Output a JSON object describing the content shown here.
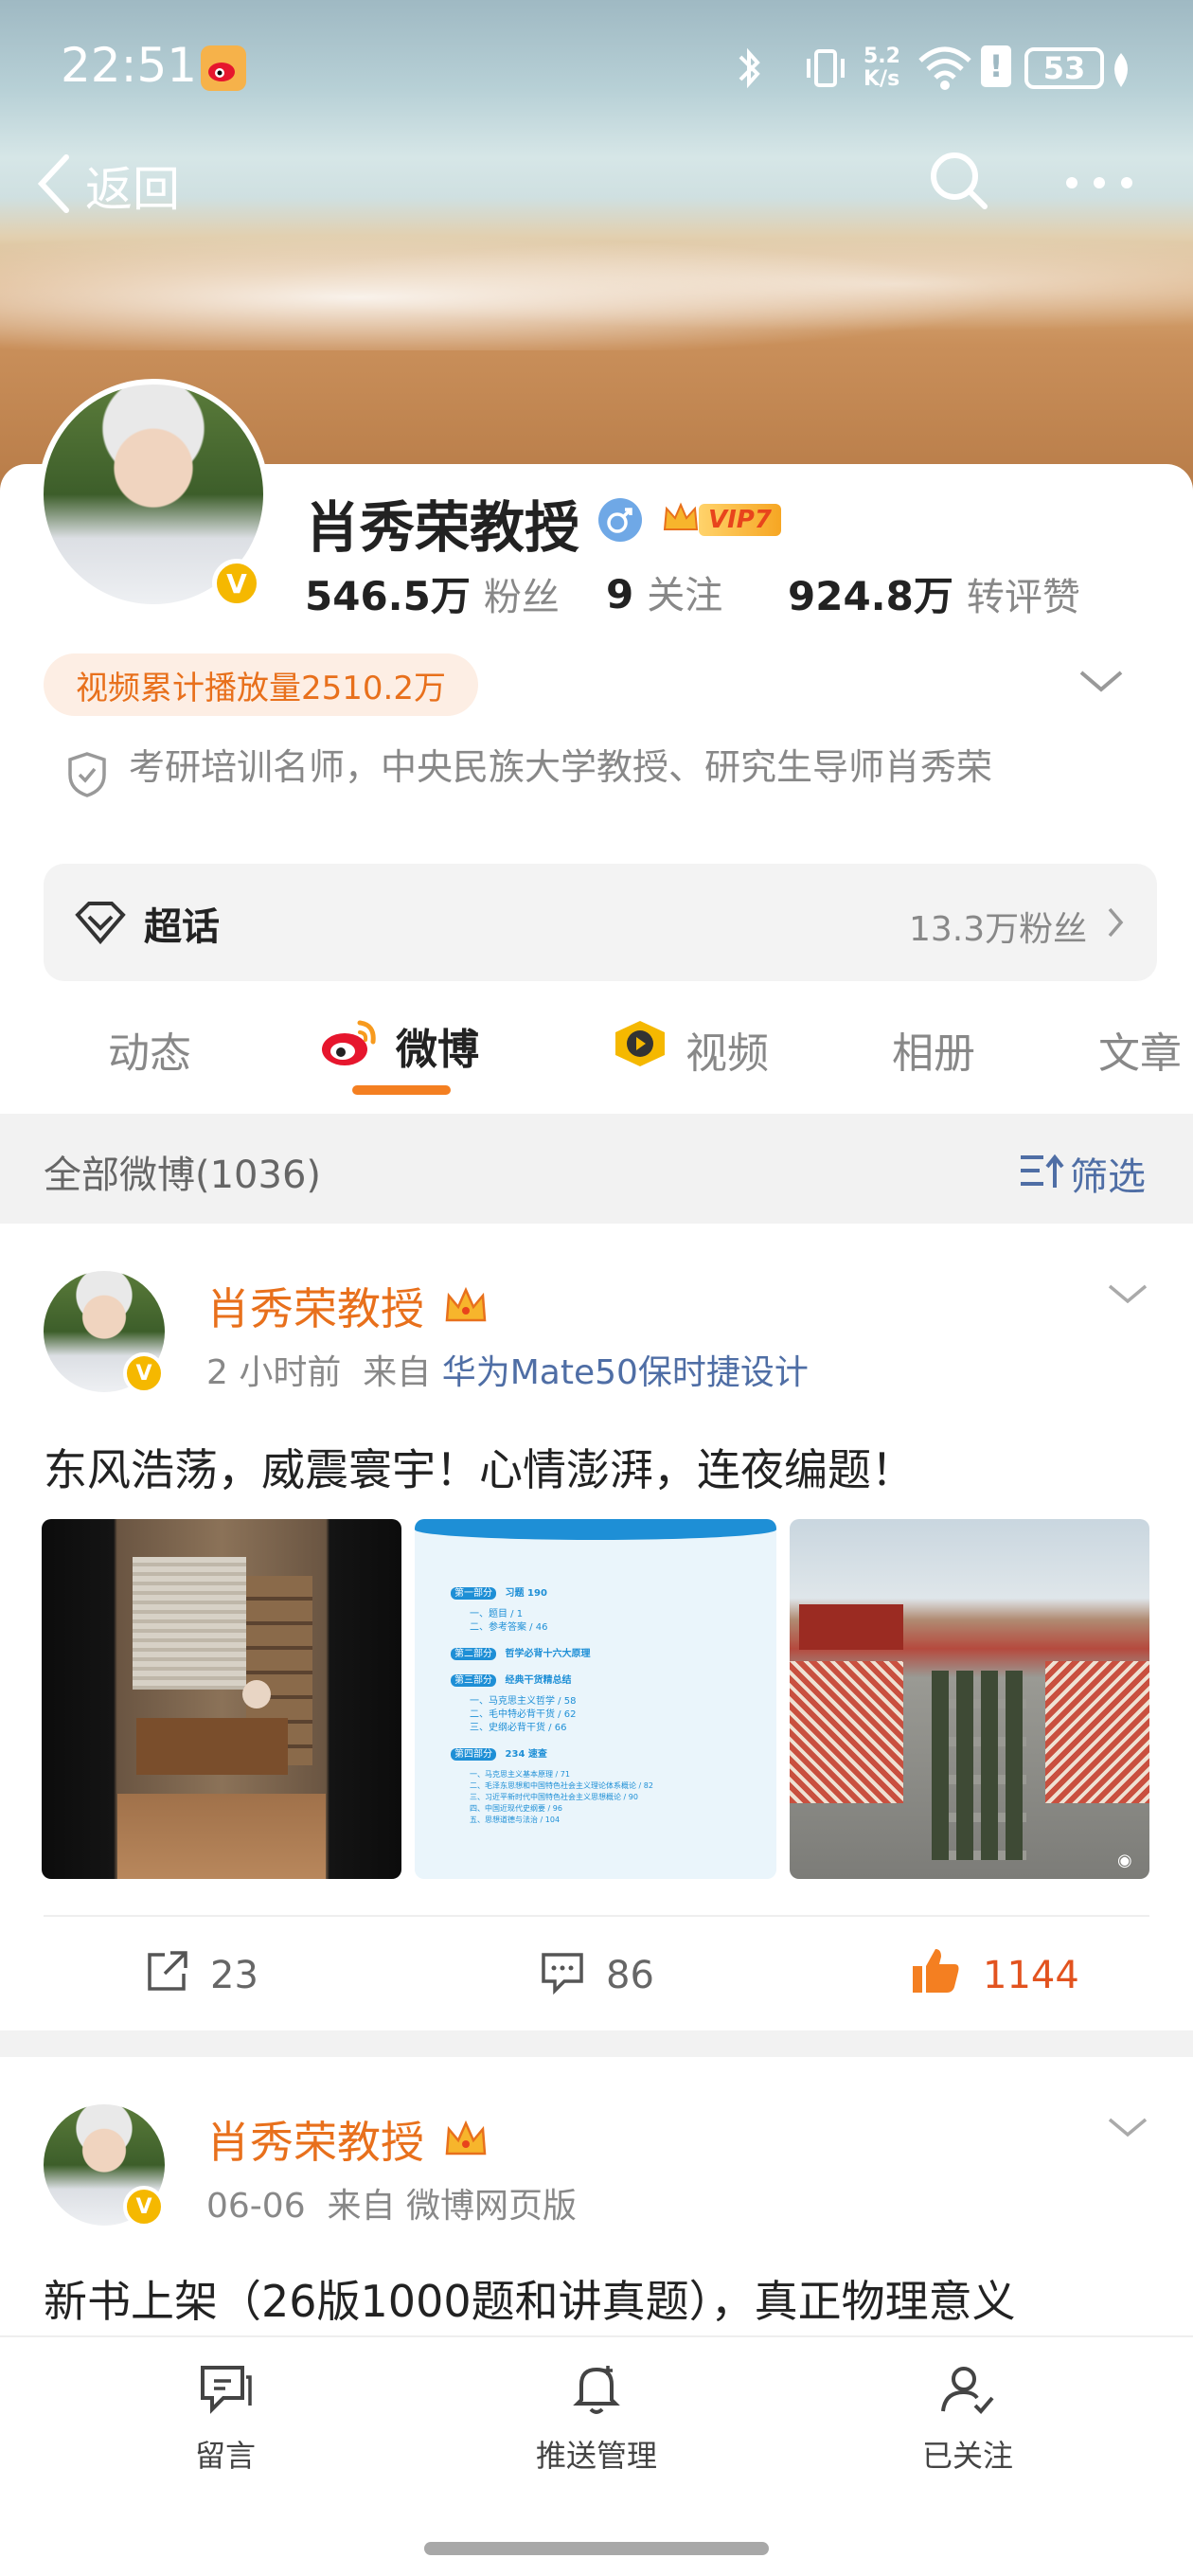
{
  "status_bar": {
    "time": "22:51",
    "network_speed": "5.2\nK/s",
    "battery": "53"
  },
  "header": {
    "back_label": "返回"
  },
  "profile": {
    "name": "肖秀荣教授",
    "gender_icon": "male-icon",
    "vip_label": "VIP7",
    "verified_badge": "V",
    "stats": [
      {
        "value": "546.5万",
        "label": "粉丝"
      },
      {
        "value": "9",
        "label": "关注"
      },
      {
        "value": "924.8万",
        "label": "转评赞"
      }
    ],
    "video_plays": "视频累计播放量2510.2万",
    "bio": "考研培训名师，中央民族大学教授、研究生导师肖秀荣",
    "supertopic": {
      "label": "超话",
      "fans": "13.3万粉丝"
    }
  },
  "tabs": [
    {
      "label": "动态",
      "active": false
    },
    {
      "label": "微博",
      "active": true
    },
    {
      "label": "视频",
      "active": false
    },
    {
      "label": "相册",
      "active": false
    },
    {
      "label": "文章",
      "active": false
    }
  ],
  "feed_header": {
    "title": "全部微博(1036)",
    "filter_label": "筛选"
  },
  "posts": [
    {
      "author": "肖秀荣教授",
      "time": "2 小时前",
      "from_prefix": "来自",
      "source": "华为Mate50保时捷设计",
      "text": "东风浩荡，威震寰宇！心情澎湃，连夜编题！",
      "images": [
        "study-room-photo",
        "book-contents-page",
        "military-parade-photo"
      ],
      "doc_lines": {
        "p1": "第一部分",
        "p1_title": "习题 190",
        "p1_items": [
          "一、题目 / 1",
          "二、参考答案 / 46"
        ],
        "p2": "第二部分",
        "p2_title": "哲学必背十六大原理",
        "p3": "第三部分",
        "p3_title": "经典干货精总结",
        "p3_items": [
          "一、马克思主义哲学 / 58",
          "二、毛中特必背干货 / 62",
          "三、史纲必背干货 / 66"
        ],
        "p4": "第四部分",
        "p4_title": "234 速查",
        "p4_items": [
          "一、马克思主义基本原理 / 71",
          "二、毛泽东思想和中国特色社会主义理论体系概论 / 82",
          "三、习近平新时代中国特色社会主义思想概论 / 90",
          "四、中国近现代史纲要 / 96",
          "五、思想道德与法治 / 104"
        ]
      },
      "reposts": "23",
      "comments": "86",
      "likes": "1144"
    },
    {
      "author": "肖秀荣教授",
      "time": "06-06",
      "from_prefix": "来自",
      "source": "微博网页版",
      "text": "新书上架（26版1000题和讲真题），真正物理意义"
    }
  ],
  "bottom_nav": [
    {
      "label": "留言",
      "icon": "message-icon"
    },
    {
      "label": "推送管理",
      "icon": "bell-icon"
    },
    {
      "label": "已关注",
      "icon": "followed-user-icon"
    }
  ],
  "colors": {
    "accent_orange": "#e8701c",
    "source_blue": "#4f6ea5",
    "verified_gold": "#f5b800",
    "like_red": "#e2531f"
  }
}
